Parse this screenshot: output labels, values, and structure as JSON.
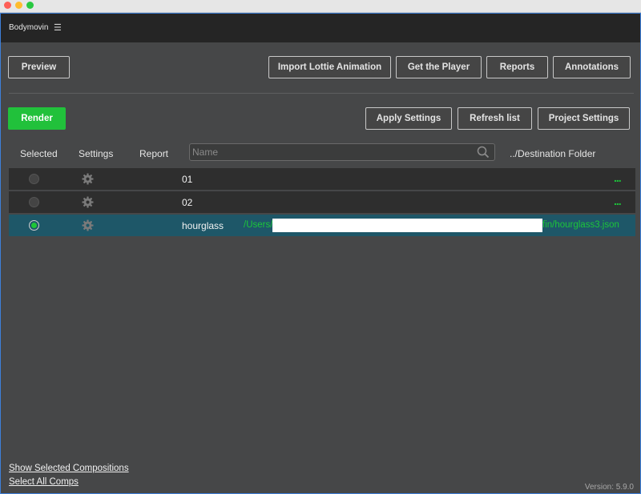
{
  "app": {
    "title": "Bodymovin",
    "menu_icon": "hamburger-icon",
    "version": "Version: 5.9.0"
  },
  "toolbar_top": {
    "preview": "Preview",
    "import_lottie": "Import Lottie Animation",
    "get_player": "Get the Player",
    "reports": "Reports",
    "annotations": "Annotations"
  },
  "toolbar_second": {
    "render": "Render",
    "apply_settings": "Apply Settings",
    "refresh_list": "Refresh list",
    "project_settings": "Project Settings"
  },
  "columns": {
    "selected": "Selected",
    "settings": "Settings",
    "report": "Report",
    "destination": "../Destination Folder"
  },
  "search": {
    "placeholder": "Name",
    "value": ""
  },
  "comps": [
    {
      "name": "01",
      "selected": false,
      "destination_prefix": "",
      "destination_suffix": "",
      "more": "..."
    },
    {
      "name": "02",
      "selected": false,
      "destination_prefix": "",
      "destination_suffix": "",
      "more": "..."
    },
    {
      "name": "hourglass",
      "selected": true,
      "destination_prefix": "/Users/",
      "destination_suffix": "fin/hourglass3.json",
      "more": ""
    }
  ],
  "footer": {
    "show_selected": "Show Selected Compositions",
    "select_all": "Select All Comps"
  },
  "colors": {
    "accent_green": "#21c13b",
    "selected_row": "#1e5768",
    "panel_bg": "#464748",
    "header_bg": "#252525"
  }
}
